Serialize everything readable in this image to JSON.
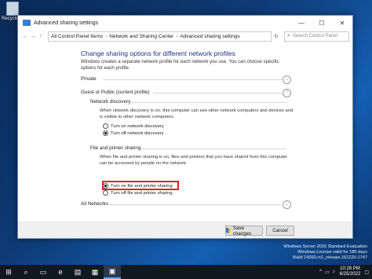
{
  "desktop": {
    "recycle_label": "Recycle Bin"
  },
  "window": {
    "title": "Advanced sharing settings",
    "controls": {
      "minimize": "—",
      "maximize": "☐",
      "close": "✕"
    }
  },
  "address": {
    "crumbs": [
      "All Control Panel Items",
      "Network and Sharing Center",
      "Advanced sharing settings"
    ],
    "search_placeholder": "Search Control Panel"
  },
  "page": {
    "heading": "Change sharing options for different network profiles",
    "intro": "Windows creates a separate network profile for each network you use. You can choose specific options for each profile.",
    "private_label": "Private",
    "guest_label": "Guest or Public (current profile)",
    "all_networks_label": "All Networks",
    "network_discovery": {
      "title": "Network discovery",
      "desc": "When network discovery is on, this computer can see other network computers and devices and is visible to other network computers.",
      "options": [
        "Turn on network discovery",
        "Turn off network discovery"
      ],
      "selected": "Turn off network discovery"
    },
    "file_sharing": {
      "title": "File and printer sharing",
      "desc": "When file and printer sharing is on, files and printers that you have shared from this computer can be accessed by people on the network.",
      "options": [
        "Turn on file and printer sharing",
        "Turn off file and printer sharing"
      ],
      "selected": "Turn on file and printer sharing"
    }
  },
  "footer": {
    "save_label": "Save changes",
    "cancel_label": "Cancel"
  },
  "watermark": {
    "line1": "Windows Server 2016 Standard Evaluation",
    "line2": "Windows License valid for 180 days",
    "line3": "Build 14393.rs1_release.161220-1747"
  },
  "taskbar": {
    "time": "10:28 PM",
    "date": "6/25/2022"
  },
  "colors": {
    "highlight": "#e0212b",
    "heading": "#1e3287"
  }
}
